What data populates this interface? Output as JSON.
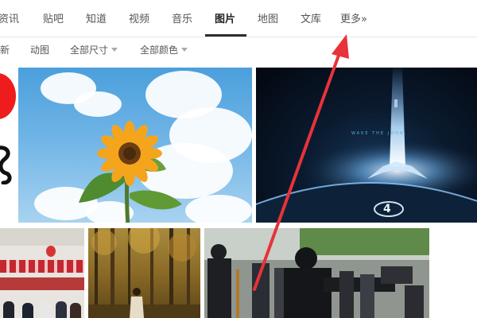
{
  "nav": {
    "tabs": [
      {
        "label": "资讯",
        "active": false
      },
      {
        "label": "贴吧",
        "active": false
      },
      {
        "label": "知道",
        "active": false
      },
      {
        "label": "视频",
        "active": false
      },
      {
        "label": "音乐",
        "active": false
      },
      {
        "label": "图片",
        "active": true
      },
      {
        "label": "地图",
        "active": false
      },
      {
        "label": "文库",
        "active": false
      },
      {
        "label": "更多»",
        "active": false
      }
    ]
  },
  "filters": {
    "latest": "最新",
    "animated": "动图",
    "size": "全部尺寸",
    "color": "全部颜色"
  },
  "images": {
    "space_caption": "WAKE THE JOHN.",
    "halo_logo_text": "4"
  },
  "colors": {
    "accent": "#2d2d2d",
    "annotation_arrow": "#e8323a"
  },
  "icons": [
    "dropdown-caret-icon"
  ]
}
